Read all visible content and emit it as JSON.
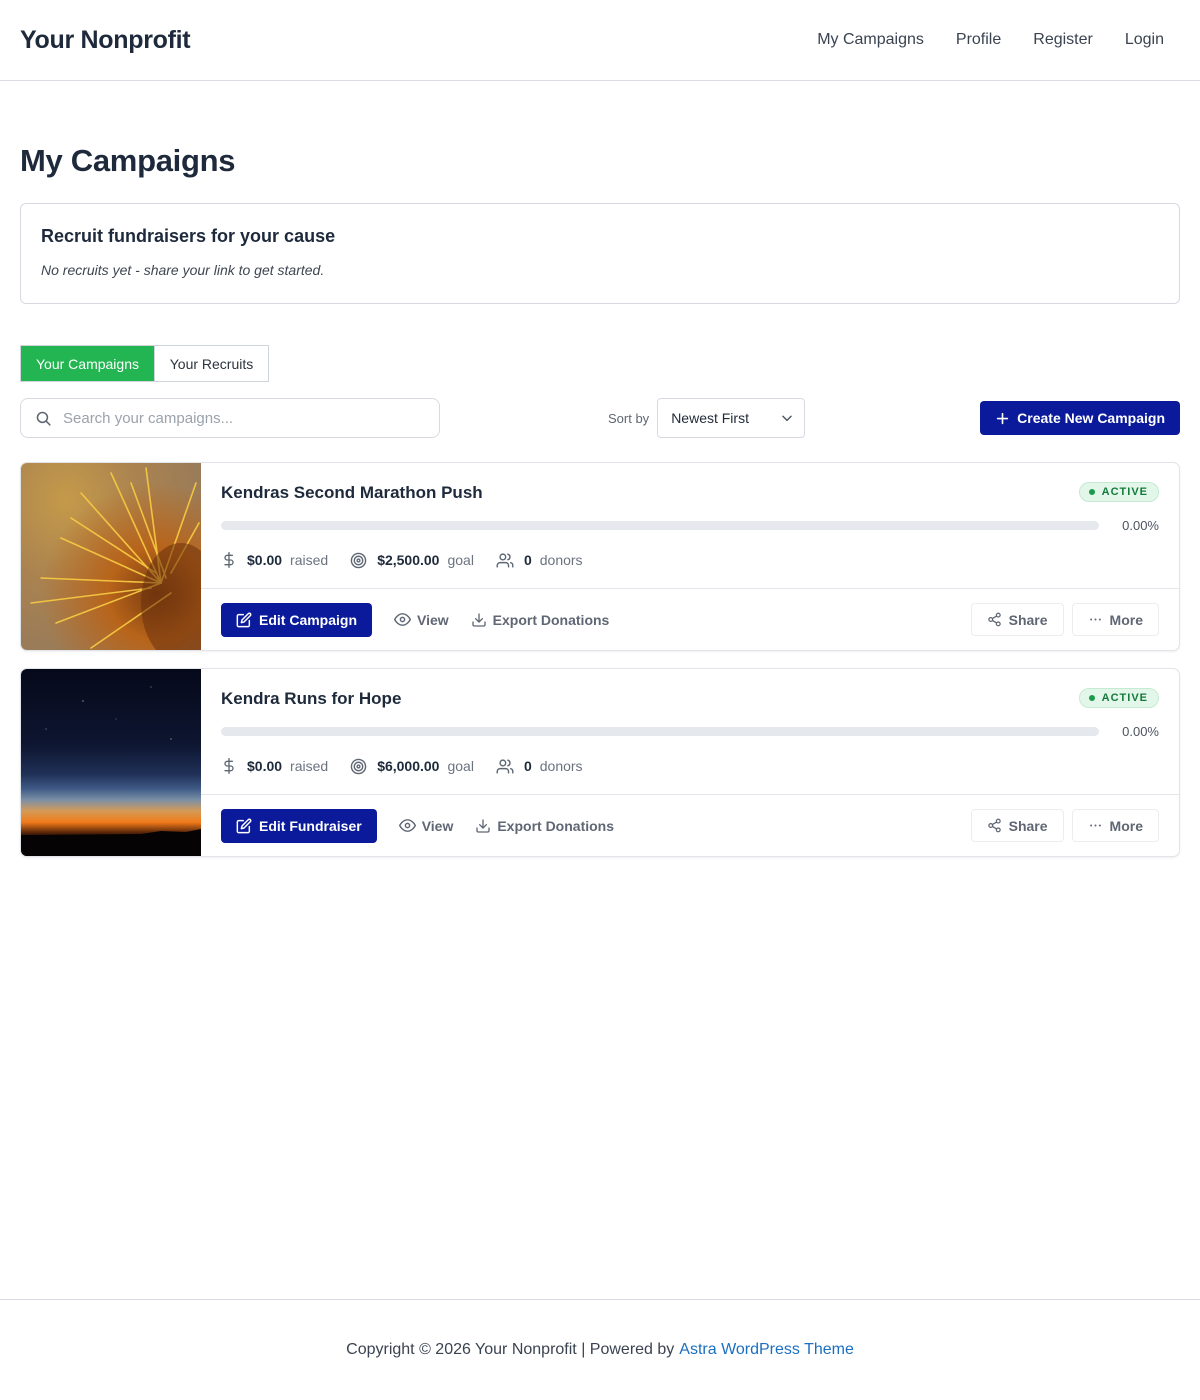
{
  "site": {
    "title": "Your Nonprofit",
    "nav": [
      "My Campaigns",
      "Profile",
      "Register",
      "Login"
    ]
  },
  "page": {
    "title": "My Campaigns"
  },
  "recruit": {
    "title": "Recruit fundraisers for your cause",
    "empty_text": "No recruits yet - share your link to get started."
  },
  "tabs": {
    "active": "Your Campaigns",
    "inactive": "Your Recruits"
  },
  "toolbar": {
    "search_placeholder": "Search your campaigns...",
    "sort_label": "Sort by",
    "sort_value": "Newest First",
    "create_label": "Create New Campaign"
  },
  "campaigns": [
    {
      "title": "Kendras Second Marathon Push",
      "status": "ACTIVE",
      "progress_pct": "0.00%",
      "progress_fraction": 0,
      "raised": "$0.00",
      "raised_label": "raised",
      "goal": "$2,500.00",
      "goal_label": "goal",
      "donors": "0",
      "donors_label": "donors",
      "edit_label": "Edit Campaign",
      "view_label": "View",
      "export_label": "Export Donations",
      "share_label": "Share",
      "more_label": "More"
    },
    {
      "title": "Kendra Runs for Hope",
      "status": "ACTIVE",
      "progress_pct": "0.00%",
      "progress_fraction": 0,
      "raised": "$0.00",
      "raised_label": "raised",
      "goal": "$6,000.00",
      "goal_label": "goal",
      "donors": "0",
      "donors_label": "donors",
      "edit_label": "Edit Fundraiser",
      "view_label": "View",
      "export_label": "Export Donations",
      "share_label": "Share",
      "more_label": "More"
    }
  ],
  "footer": {
    "text": "Copyright © 2026 Your Nonprofit | Powered by",
    "link": "Astra WordPress Theme"
  },
  "colors": {
    "primary": "#0a1a9a",
    "success": "#22b551",
    "link": "#1b6fc2"
  }
}
